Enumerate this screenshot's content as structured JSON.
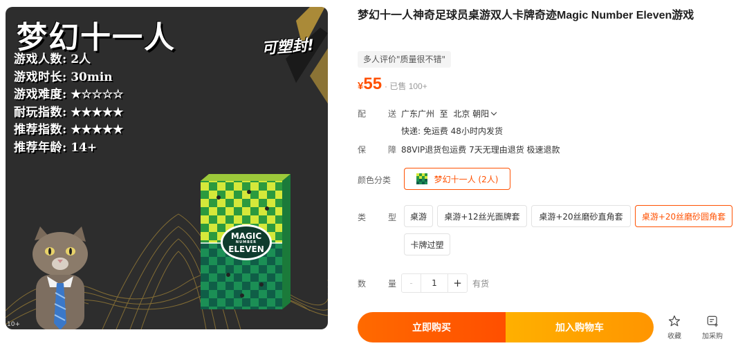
{
  "image": {
    "headline": "梦幻十一人",
    "specs": [
      {
        "key": "游戏人数",
        "value": "2人"
      },
      {
        "key": "游戏时长",
        "value": "30min"
      },
      {
        "key": "游戏难度",
        "value": "★☆☆☆☆"
      },
      {
        "key": "耐玩指数",
        "value": "★★★★★"
      },
      {
        "key": "推荐指数",
        "value": "★★★★★"
      },
      {
        "key": "推荐年龄",
        "value": "14+"
      }
    ],
    "reseal_badge": "可塑封!",
    "box_logo_line1": "MAGIC",
    "box_logo_line2": "NUMBER",
    "box_logo_line3": "ELEVEN",
    "corner_mark": "10+",
    "colors": {
      "bg": "#2d2d2d",
      "gold": "#c9a13b",
      "box_green": "#1f8a4a",
      "box_yellow": "#d5e83a"
    }
  },
  "product": {
    "title": "梦幻十一人神奇足球员桌游双人卡牌奇迹Magic Number Eleven游戏",
    "review_tag": "多人评价\"质量很不错\"",
    "price_currency": "¥",
    "price": "55",
    "sold": "· 已售 100+"
  },
  "shipping": {
    "label_a": "配",
    "label_b": "送",
    "from": "广东广州",
    "to_word": "至",
    "to": "北京 朝阳",
    "detail": "快递: 免运费  48小时内发货"
  },
  "guarantee": {
    "label_a": "保",
    "label_b": "障",
    "text": "88VIP退货包运费 7天无理由退货 极速退款"
  },
  "color_category": {
    "label": "颜色分类",
    "option": "梦幻十一人 (2人)"
  },
  "type": {
    "label_a": "类",
    "label_b": "型",
    "options": [
      "桌游",
      "桌游+12丝光面牌套",
      "桌游+20丝磨砂直角套",
      "桌游+20丝磨砂圆角套",
      "卡牌过塑"
    ],
    "selected_index": 3
  },
  "quantity": {
    "label_a": "数",
    "label_b": "量",
    "minus": "-",
    "value": "1",
    "plus": "+",
    "stock": "有货"
  },
  "actions": {
    "buy_now": "立即购买",
    "add_to_cart": "加入购物车",
    "favorite": "收藏",
    "add_purchase": "加采购"
  },
  "accent_color": "#ff5000"
}
